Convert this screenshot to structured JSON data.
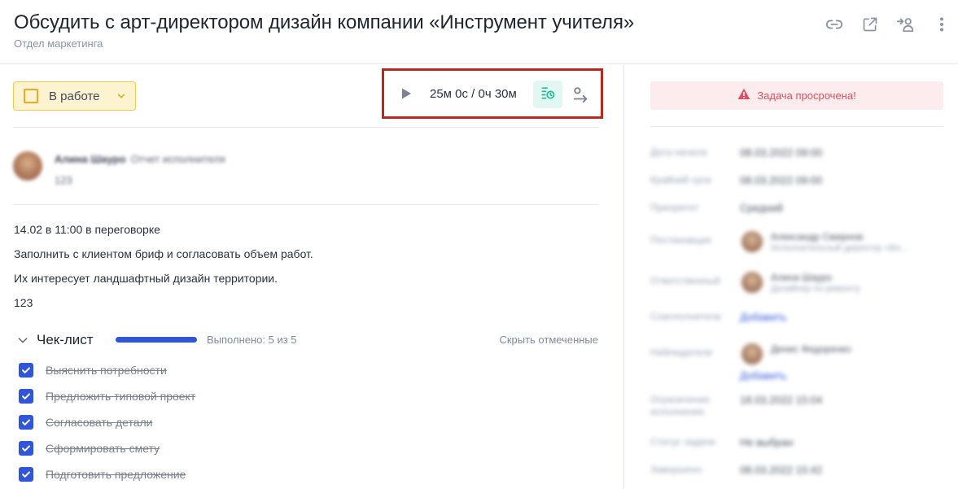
{
  "header": {
    "title": "Обсудить с арт-директором дизайн компании «Инструмент учителя»",
    "subtitle": "Отдел маркетинга"
  },
  "icons": {
    "link": "link-icon",
    "open_external": "external-link-icon",
    "add_user": "add-user-icon",
    "more": "more-vertical-icon"
  },
  "toolbar": {
    "status_label": "В работе",
    "timer_text": "25м 0с / 0ч 30м"
  },
  "comment": {
    "author": "Алина Шауро",
    "action": "Отчет исполнителя",
    "text": "123"
  },
  "description": [
    "14.02 в 11:00 в переговорке",
    "Заполнить с клиентом бриф и согласовать объем работ.",
    "Их интересует ландшафтный дизайн территории.",
    "123"
  ],
  "checklist": {
    "title": "Чек-лист",
    "progress_percent": 100,
    "done_text": "Выполнено: 5 из 5",
    "hide_label": "Скрыть отмеченные",
    "items": [
      {
        "label": "Выяснить потребности",
        "checked": true
      },
      {
        "label": "Предложить типовой проект",
        "checked": true
      },
      {
        "label": "Согласовать детали",
        "checked": true
      },
      {
        "label": "Сформировать смету",
        "checked": true
      },
      {
        "label": "Подготовить предложение",
        "checked": true
      }
    ]
  },
  "sidebar": {
    "overdue_text": "Задача просрочена!",
    "fields": [
      {
        "key": "Дата начала",
        "value": "08.03.2022 09:00"
      },
      {
        "key": "Крайний срок",
        "value": "08.03.2022 09:00"
      },
      {
        "key": "Приоритет",
        "value": "Средний"
      },
      {
        "key": "Постановщик",
        "name": "Александр Смирнов",
        "role": "Исполнительный директор «Бо..."
      },
      {
        "key": "Ответственный",
        "name": "Алина Шауро",
        "role": "Дизайнер по ремонту"
      },
      {
        "key": "Соисполнители",
        "link": "Добавить"
      },
      {
        "key": "Наблюдатели",
        "name": "Денис Федоренко",
        "link": "Добавить"
      },
      {
        "key": "Ограничение исполнения",
        "value": "18.03.2022 15:04"
      },
      {
        "key": "Статус задачи",
        "value": "Не выбран"
      },
      {
        "key": "Завершено",
        "value": "08.03.2022 15:42"
      }
    ]
  },
  "colors": {
    "accent": "#2f56d8",
    "status_bg": "#fdf3d0",
    "status_border": "#f2c94c",
    "timer_highlight": "#b8281d",
    "overdue_bg": "#fdecee",
    "overdue_text": "#e24f5e"
  }
}
